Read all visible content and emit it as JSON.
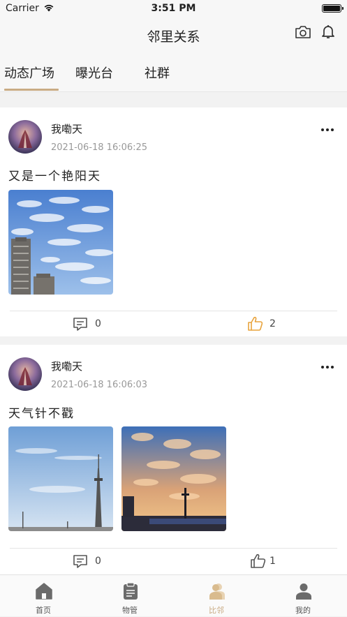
{
  "status_bar": {
    "carrier": "Carrier",
    "time": "3:51 PM"
  },
  "nav": {
    "title": "邻里关系"
  },
  "tabs": [
    {
      "label": "动态广场",
      "active": true
    },
    {
      "label": "曝光台",
      "active": false
    },
    {
      "label": "社群",
      "active": false
    }
  ],
  "posts": [
    {
      "username": "我嘞天",
      "timestamp": "2021-06-18 16:06:25",
      "text": "又是一个艳阳天",
      "photos": [
        "sky-building-photo"
      ],
      "comments": "0",
      "likes": "2",
      "liked": true
    },
    {
      "username": "我嘞天",
      "timestamp": "2021-06-18 16:06:03",
      "text": "天气针不戳",
      "photos": [
        "sky-tower-photo",
        "sunset-tower-photo"
      ],
      "comments": "0",
      "likes": "1",
      "liked": false
    }
  ],
  "tabbar": [
    {
      "label": "首页",
      "icon": "home-icon",
      "active": false
    },
    {
      "label": "物管",
      "icon": "property-icon",
      "active": false
    },
    {
      "label": "比邻",
      "icon": "neighbor-icon",
      "active": true
    },
    {
      "label": "我的",
      "icon": "profile-icon",
      "active": false
    }
  ],
  "colors": {
    "accent": "#c9ab84",
    "like_active": "#e8a33c",
    "muted": "#999999"
  }
}
